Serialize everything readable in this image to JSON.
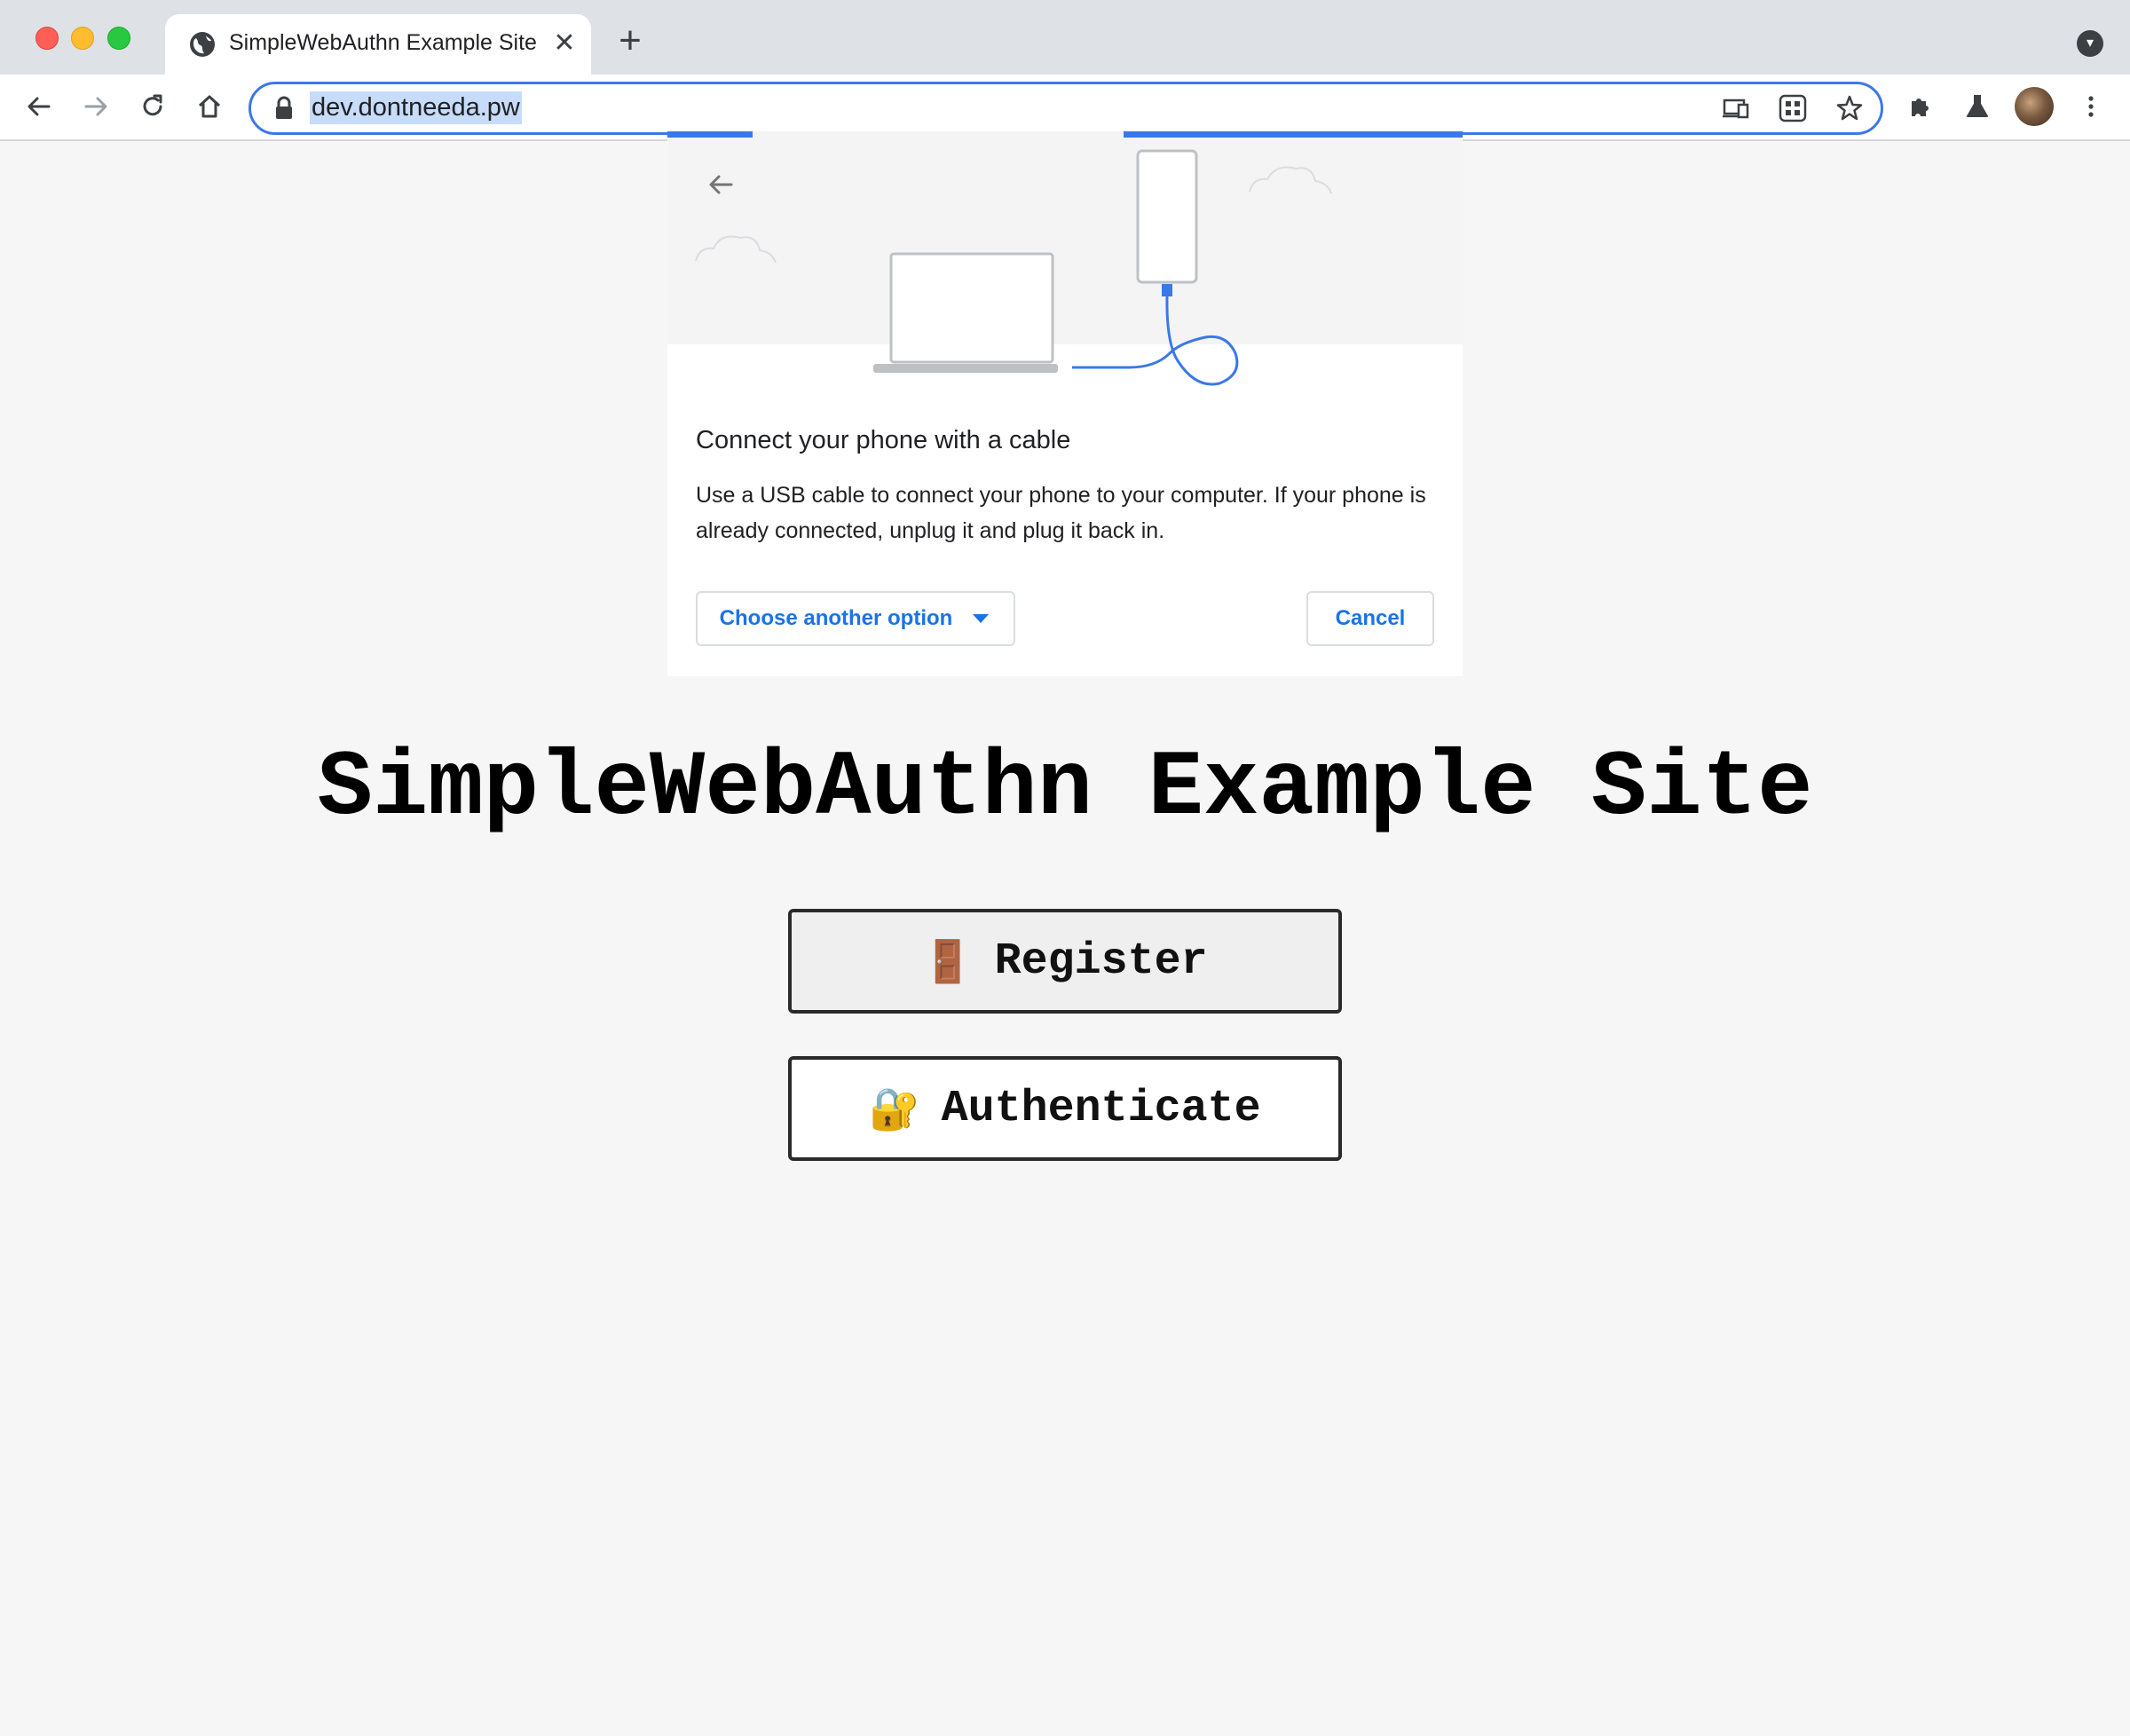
{
  "browser": {
    "tab_title": "SimpleWebAuthn Example Site",
    "tab_close_label": "✕",
    "new_tab_label": "+",
    "url": "dev.dontneeda.pw"
  },
  "dialog": {
    "title": "Connect your phone with a cable",
    "body": "Use a USB cable to connect your phone to your computer. If your phone is already connected, unplug it and plug it back in.",
    "choose_option_label": "Choose another option",
    "cancel_label": "Cancel"
  },
  "page": {
    "title": "SimpleWebAuthn Example Site",
    "register_icon": "🚪",
    "register_label": "Register",
    "authenticate_icon": "🔐",
    "authenticate_label": "Authenticate"
  },
  "colors": {
    "accent": "#3b78e7",
    "link": "#1a73e8",
    "page_bg": "#f6f6f6",
    "register_bg": "#efefef",
    "authenticate_bg": "#ffffff"
  }
}
